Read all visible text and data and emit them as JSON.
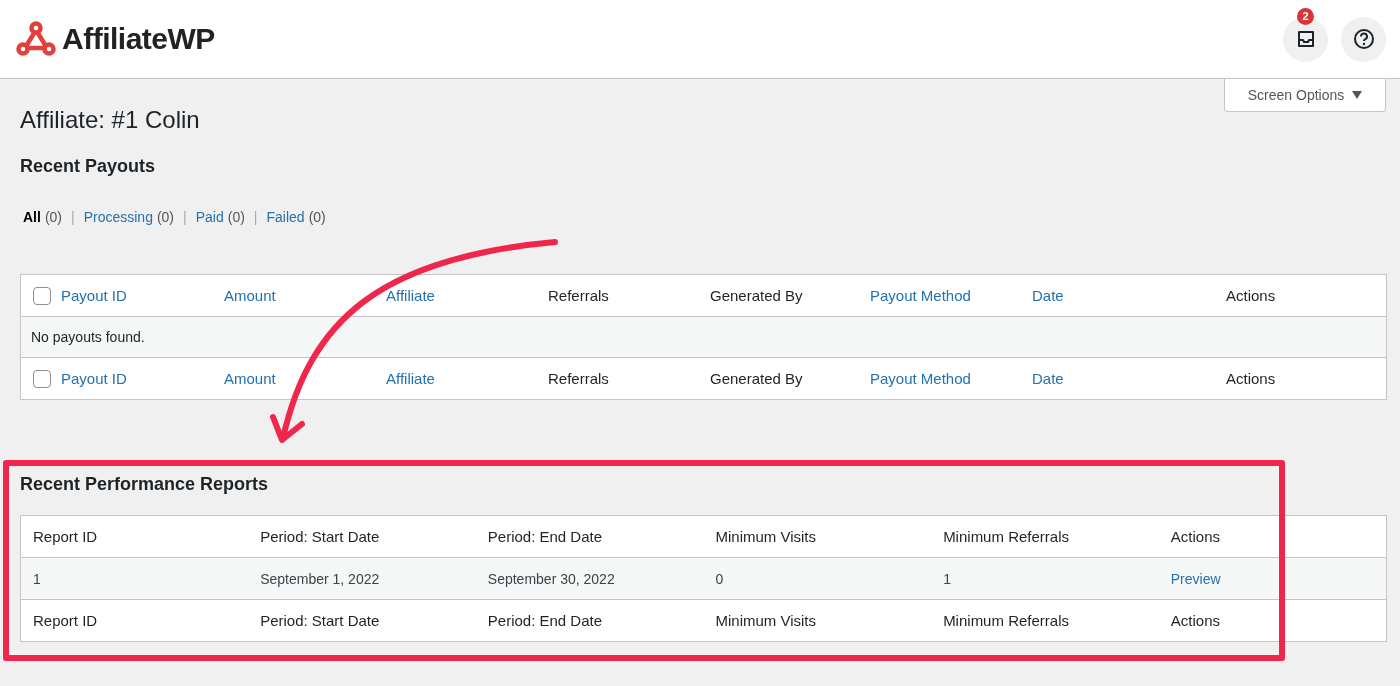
{
  "header": {
    "logo": "AffiliateWP",
    "notifications": {
      "badge": "2"
    }
  },
  "screen_options": {
    "label": "Screen Options",
    "expanded": false
  },
  "page_title": "Affiliate: #1 Colin",
  "payouts": {
    "title": "Recent Payouts",
    "filters": [
      {
        "label": "All",
        "count": "(0)",
        "selected": true
      },
      {
        "separator": "|",
        "label": "Processing",
        "count": "(0)",
        "selected": false
      },
      {
        "separator": "|",
        "label": "Paid",
        "count": "(0)",
        "selected": false
      },
      {
        "separator": "|",
        "label": "Failed",
        "count": "(0)",
        "selected": false
      }
    ],
    "header_checked": false,
    "footer_checked": false,
    "header_columns": [
      {
        "label": "Payout ID",
        "sortable": true
      },
      {
        "label": "Amount",
        "sortable": true
      },
      {
        "label": "Affiliate",
        "sortable": true
      },
      {
        "label": "Referrals",
        "sortable": false
      },
      {
        "label": "Generated By",
        "sortable": false
      },
      {
        "label": "Payout Method",
        "sortable": true
      },
      {
        "label": "Date",
        "sortable": true
      },
      {
        "label": "Actions",
        "sortable": false
      }
    ],
    "empty_message": "No payouts found.",
    "footer_columns": [
      {
        "label": "Payout ID",
        "sortable": true
      },
      {
        "label": "Amount",
        "sortable": true
      },
      {
        "label": "Affiliate",
        "sortable": true
      },
      {
        "label": "Referrals",
        "sortable": false
      },
      {
        "label": "Generated By",
        "sortable": false
      },
      {
        "label": "Payout Method",
        "sortable": true
      },
      {
        "label": "Date",
        "sortable": true
      },
      {
        "label": "Actions",
        "sortable": false
      }
    ]
  },
  "reports": {
    "title": "Recent Performance Reports",
    "header_columns": [
      "Report ID",
      "Period: Start Date",
      "Period: End Date",
      "Minimum Visits",
      "Minimum Referrals",
      "Actions"
    ],
    "rows": [
      [
        {
          "kind": "text",
          "text": "1"
        },
        {
          "kind": "text",
          "text": "September 1, 2022"
        },
        {
          "kind": "text",
          "text": "September 30, 2022"
        },
        {
          "kind": "text",
          "text": "0"
        },
        {
          "kind": "text",
          "text": "1"
        },
        {
          "kind": "link",
          "text": "Preview"
        }
      ]
    ],
    "footer_columns": [
      "Report ID",
      "Period: Start Date",
      "Period: End Date",
      "Minimum Visits",
      "Minimum Referrals",
      "Actions"
    ]
  }
}
